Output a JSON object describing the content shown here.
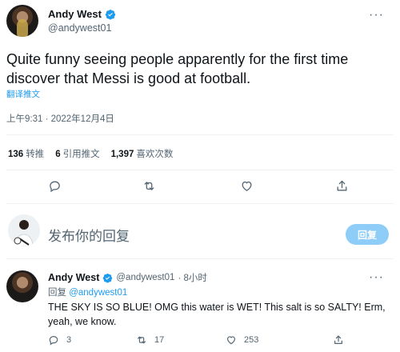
{
  "tweet": {
    "author_name": "Andy West",
    "author_handle": "@andywest01",
    "text": "Quite funny seeing people apparently for the first time discover that Messi is good at football.",
    "translate_label": "翻译推文",
    "timestamp": "上午9:31 · 2022年12月4日",
    "more_icon": "more-icon",
    "verified_color": "#1d9bf0"
  },
  "stats": [
    {
      "count": "136",
      "label": "转推"
    },
    {
      "count": "6",
      "label": "引用推文"
    },
    {
      "count": "1,397",
      "label": "喜欢次数"
    }
  ],
  "actions": [
    "reply-icon",
    "retweet-icon",
    "like-icon",
    "share-icon"
  ],
  "reply_box": {
    "placeholder": "发布你的回复",
    "button_label": "回复",
    "button_color": "#8ecdf8"
  },
  "reply": {
    "author_name": "Andy West",
    "author_handle": "@andywest01",
    "time": "· 8小时",
    "replying_to_label": "回复",
    "replying_to_handle": "@andywest01",
    "text": "THE SKY IS SO BLUE! OMG this water is WET! This salt is so SALTY! Erm, yeah, we know.",
    "reply_count": "3",
    "retweet_count": "17",
    "like_count": "253"
  }
}
